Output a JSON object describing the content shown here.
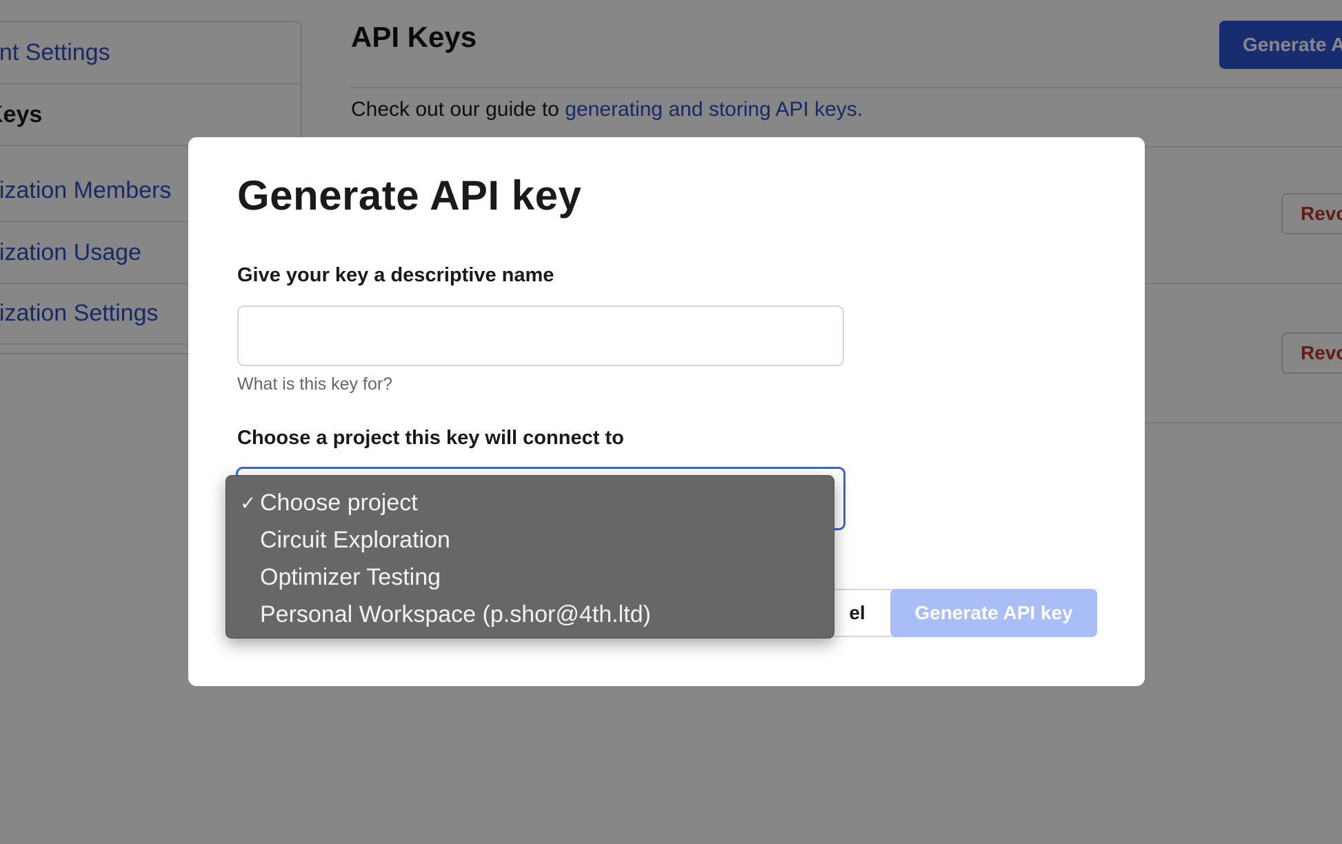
{
  "background": {
    "sidebar": {
      "items": [
        {
          "label": "unt Settings"
        },
        {
          "label": "Keys"
        },
        {
          "label": "nization Members"
        },
        {
          "label": "nization Usage"
        },
        {
          "label": "nization Settings"
        }
      ]
    },
    "title": "API Keys",
    "generate_button_label": "Generate A",
    "guide_text": "Check out our guide to ",
    "guide_link": "generating and storing API keys.",
    "revoke_label": "Revo"
  },
  "modal": {
    "title": "Generate API key",
    "name_field": {
      "label": "Give your key a descriptive name",
      "value": "",
      "placeholder": "",
      "help": "What is this key for?"
    },
    "project_field": {
      "label": "Choose a project this key will connect to"
    },
    "cancel_label": "el",
    "generate_label": "Generate API key"
  },
  "dropdown": {
    "options": [
      {
        "label": "Choose project",
        "selected": true,
        "check": "✓"
      },
      {
        "label": "Circuit Exploration",
        "selected": false
      },
      {
        "label": "Optimizer Testing",
        "selected": false
      },
      {
        "label": "Personal Workspace (p.shor@4th.ltd)",
        "selected": false
      }
    ]
  },
  "colors": {
    "accent": "#2f55d4",
    "link": "#2f4fc9",
    "danger": "#c0322b",
    "disabled_button": "#a9bdf6",
    "focus_ring": "#3a62e0"
  }
}
